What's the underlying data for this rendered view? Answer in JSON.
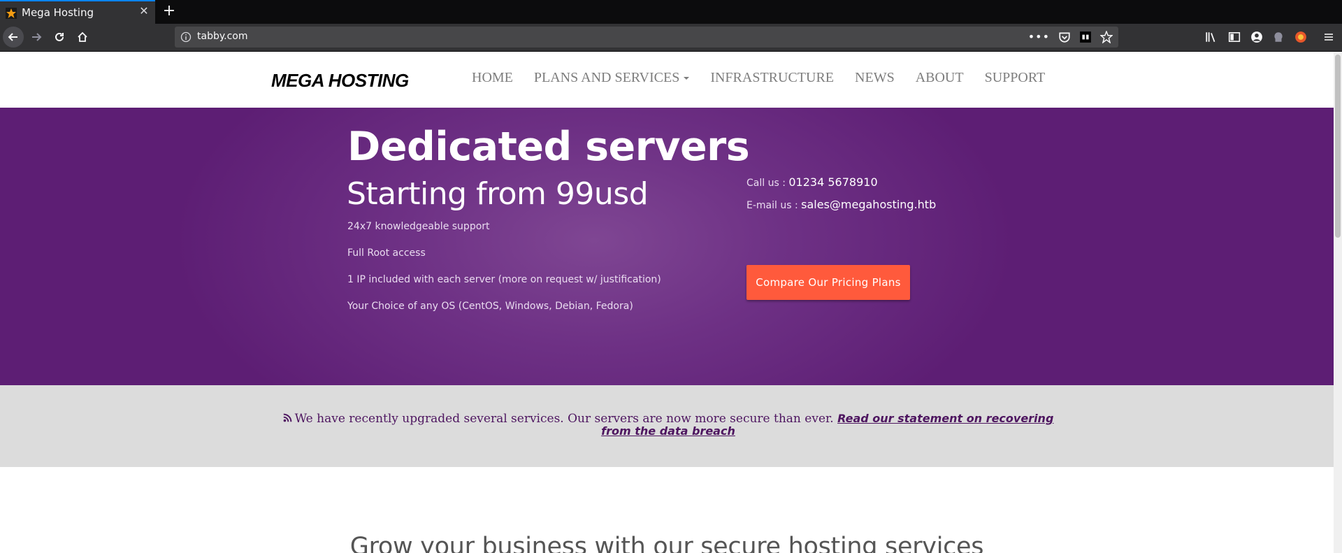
{
  "browser": {
    "tab_title": "Mega Hosting",
    "new_tab_label": "+",
    "url": "tabby.com"
  },
  "site": {
    "logo": "MEGA HOSTING",
    "nav": [
      {
        "label": "HOME"
      },
      {
        "label": "PLANS AND SERVICES"
      },
      {
        "label": "INFRASTRUCTURE"
      },
      {
        "label": "NEWS"
      },
      {
        "label": "ABOUT"
      },
      {
        "label": "SUPPORT"
      }
    ]
  },
  "hero": {
    "title": "Dedicated servers",
    "subtitle": "Starting from 99usd",
    "features": [
      "24x7 knowledgeable support",
      "Full Root access",
      "1 IP included with each server (more on request w/ justification)",
      "Your Choice of any OS (CentOS, Windows, Debian, Fedora)"
    ],
    "call_label": "Call us : ",
    "call_value": "01234 5678910",
    "email_label": "E-mail us : ",
    "email_value": "sales@megahosting.htb",
    "cta": "Compare Our Pricing Plans"
  },
  "notice": {
    "text": "We have recently upgraded several services. Our servers are now more secure than ever. ",
    "link": "Read our statement on recovering from the data breach"
  },
  "section": {
    "heading": "Grow your business with our secure hosting services"
  },
  "colors": {
    "hero_purple": "#6e3185",
    "cta_orange": "#ff5a3c",
    "notice_text": "#4e1660"
  }
}
